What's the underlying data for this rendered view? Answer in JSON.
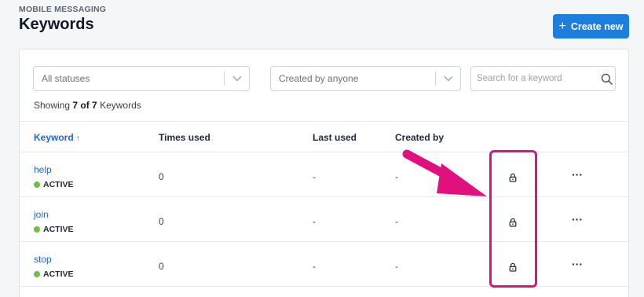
{
  "header": {
    "eyebrow": "MOBILE MESSAGING",
    "title": "Keywords",
    "create_label": "Create new"
  },
  "filters": {
    "status_value": "All statuses",
    "creator_value": "Created by anyone",
    "search_placeholder": "Search for a keyword"
  },
  "summary": {
    "prefix": "Showing",
    "count": "7 of 7",
    "suffix": "Keywords"
  },
  "table": {
    "columns": {
      "keyword": "Keyword",
      "times_used": "Times used",
      "last_used": "Last used",
      "created_by": "Created by"
    },
    "rows": [
      {
        "keyword": "help",
        "status": "ACTIVE",
        "times_used": "0",
        "last_used": "-",
        "created_by": "-"
      },
      {
        "keyword": "join",
        "status": "ACTIVE",
        "times_used": "0",
        "last_used": "-",
        "created_by": "-"
      },
      {
        "keyword": "stop",
        "status": "ACTIVE",
        "times_used": "0",
        "last_used": "-",
        "created_by": "-"
      }
    ]
  },
  "colors": {
    "primary": "#1d7fdb",
    "link": "#2466c5",
    "active_dot": "#6cc04a",
    "annotation": "#e0117f"
  },
  "icons": {
    "create": "plus-icon",
    "dropdown": "chevron-down-icon",
    "search": "search-icon",
    "lock": "lock-icon",
    "more": "more-horizontal-icon",
    "sort": "arrow-up-icon"
  }
}
